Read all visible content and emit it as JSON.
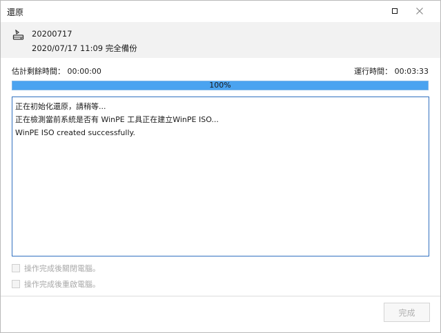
{
  "window": {
    "title": "還原",
    "maximize_icon": "maximize-icon",
    "close_icon": "close-icon"
  },
  "backup": {
    "icon": "disk-icon",
    "name": "20200717",
    "description": "2020/07/17 11:09 完全備份"
  },
  "timing": {
    "estimated_label": "估計剩餘時間：",
    "estimated_value": "00:00:00",
    "elapsed_label": "運行時間：",
    "elapsed_value": "00:03:33"
  },
  "progress": {
    "value": 100,
    "text": "100%"
  },
  "log": {
    "lines": [
      "正在初始化還原，請稍等...",
      "正在檢測當前系統是否有 WinPE 工具正在建立WinPE ISO...",
      "WinPE ISO created successfully."
    ]
  },
  "options": {
    "shutdown_label": "操作完成後關閉電腦。",
    "restart_label": "操作完成後重啟電腦。"
  },
  "footer": {
    "finish_label": "完成"
  },
  "colors": {
    "progress_fill": "#4aa3f0",
    "log_border": "#2f6fbf"
  }
}
